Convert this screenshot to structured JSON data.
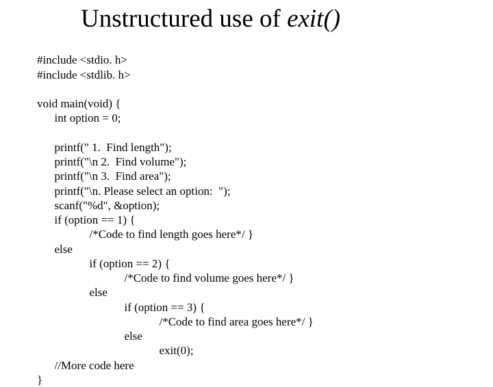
{
  "title": {
    "prefix": "Unstructured use of ",
    "fn": "exit()"
  },
  "code": {
    "l1": "#include <stdio. h>",
    "l2": "#include <stdlib. h>",
    "l3": "",
    "l4": "void main(void) {",
    "l5": "      int option = 0;",
    "l6": "",
    "l7": "      printf(\" 1.  Find length\");",
    "l8": "      printf(\"\\n 2.  Find volume\");",
    "l9": "      printf(\"\\n 3.  Find area\");",
    "l10": "      printf(\"\\n. Please select an option:  \");",
    "l11": "      scanf(\"%d\", &option);",
    "l12": "      if (option == 1) {",
    "l13": "                  /*Code to find length goes here*/ }",
    "l14": "      else",
    "l15": "                  if (option == 2) {",
    "l16": "                              /*Code to find volume goes here*/ }",
    "l17": "                  else",
    "l18": "                              if (option == 3) {",
    "l19": "                                          /*Code to find area goes here*/ }",
    "l20": "                              else",
    "l21": "                                          exit(0);",
    "l22": "      //More code here",
    "l23": "}"
  }
}
